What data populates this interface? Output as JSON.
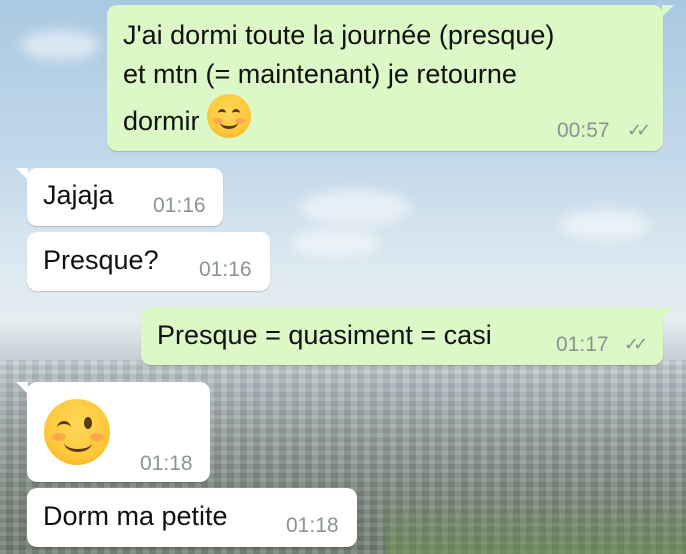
{
  "messages": [
    {
      "type": "outgoing",
      "text_lines": [
        "J'ai dormi toute la journée (presque)",
        "et mtn (= maintenant) je retourne",
        "dormir"
      ],
      "emoji": "smiling-face-with-smiling-eyes",
      "time": "00:57",
      "status": "read-double-check"
    },
    {
      "type": "incoming",
      "text": "Jajaja",
      "time": "01:16"
    },
    {
      "type": "incoming",
      "text": "Presque?",
      "time": "01:16"
    },
    {
      "type": "outgoing",
      "text": "Presque = quasiment = casi",
      "time": "01:17",
      "status": "read-double-check"
    },
    {
      "type": "incoming",
      "emoji": "winking-face",
      "time": "01:18"
    },
    {
      "type": "incoming",
      "text": "Dorm ma petite",
      "time": "01:18"
    }
  ],
  "colors": {
    "outgoing_bubble": "#dcf8c6",
    "incoming_bubble": "#ffffff",
    "timestamp": "#8a9490"
  },
  "ticks_glyph": "✓✓"
}
